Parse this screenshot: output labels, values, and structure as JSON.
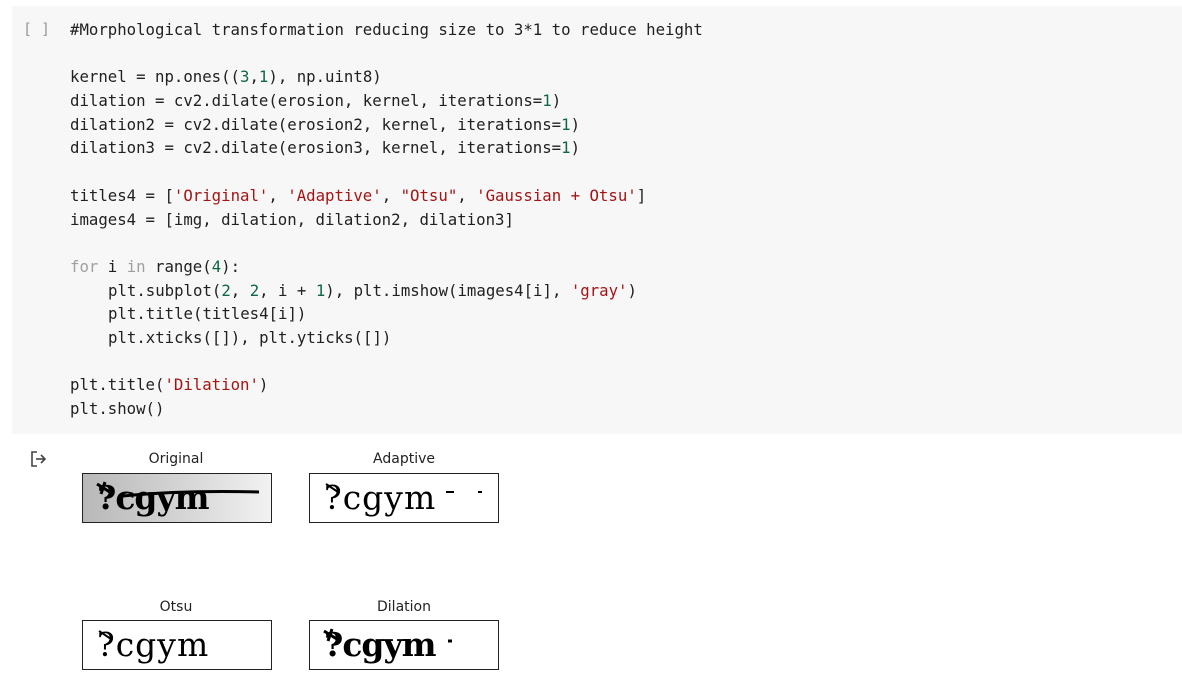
{
  "cell": {
    "run_label": "[ ]",
    "lines": [
      {
        "indent": 0,
        "tokens": [
          {
            "t": "#Morphological transformation reducing size to 3*1 to reduce height",
            "c": "c-comment"
          }
        ]
      },
      {
        "indent": 0,
        "tokens": []
      },
      {
        "indent": 0,
        "tokens": [
          {
            "t": "kernel = np.ones((",
            "c": "c-code"
          },
          {
            "t": "3",
            "c": "c-num"
          },
          {
            "t": ",",
            "c": "c-code"
          },
          {
            "t": "1",
            "c": "c-num"
          },
          {
            "t": "), np.uint8)",
            "c": "c-code"
          }
        ]
      },
      {
        "indent": 0,
        "tokens": [
          {
            "t": "dilation = cv2.dilate(erosion, kernel, iterations=",
            "c": "c-code"
          },
          {
            "t": "1",
            "c": "c-num"
          },
          {
            "t": ")",
            "c": "c-code"
          }
        ]
      },
      {
        "indent": 0,
        "tokens": [
          {
            "t": "dilation2 = cv2.dilate(erosion2, kernel, iterations=",
            "c": "c-code"
          },
          {
            "t": "1",
            "c": "c-num"
          },
          {
            "t": ")",
            "c": "c-code"
          }
        ]
      },
      {
        "indent": 0,
        "tokens": [
          {
            "t": "dilation3 = cv2.dilate(erosion3, kernel, iterations=",
            "c": "c-code"
          },
          {
            "t": "1",
            "c": "c-num"
          },
          {
            "t": ")",
            "c": "c-code"
          }
        ]
      },
      {
        "indent": 0,
        "tokens": []
      },
      {
        "indent": 0,
        "tokens": [
          {
            "t": "titles4 = [",
            "c": "c-code"
          },
          {
            "t": "'Original'",
            "c": "c-str"
          },
          {
            "t": ", ",
            "c": "c-code"
          },
          {
            "t": "'Adaptive'",
            "c": "c-str"
          },
          {
            "t": ", ",
            "c": "c-code"
          },
          {
            "t": "\"Otsu\"",
            "c": "c-str"
          },
          {
            "t": ", ",
            "c": "c-code"
          },
          {
            "t": "'Gaussian + Otsu'",
            "c": "c-str"
          },
          {
            "t": "]",
            "c": "c-code"
          }
        ]
      },
      {
        "indent": 0,
        "tokens": [
          {
            "t": "images4 = [img, dilation, dilation2, dilation3]",
            "c": "c-code"
          }
        ]
      },
      {
        "indent": 0,
        "tokens": []
      },
      {
        "indent": 0,
        "tokens": [
          {
            "t": "for",
            "c": "c-kw"
          },
          {
            "t": " i ",
            "c": "c-code"
          },
          {
            "t": "in",
            "c": "c-kw"
          },
          {
            "t": " range(",
            "c": "c-code"
          },
          {
            "t": "4",
            "c": "c-num"
          },
          {
            "t": "):",
            "c": "c-code"
          }
        ]
      },
      {
        "indent": 1,
        "tokens": [
          {
            "t": "plt.subplot(",
            "c": "c-code"
          },
          {
            "t": "2",
            "c": "c-num"
          },
          {
            "t": ", ",
            "c": "c-code"
          },
          {
            "t": "2",
            "c": "c-num"
          },
          {
            "t": ", i + ",
            "c": "c-code"
          },
          {
            "t": "1",
            "c": "c-num"
          },
          {
            "t": "), plt.imshow(images4[i], ",
            "c": "c-code"
          },
          {
            "t": "'gray'",
            "c": "c-str"
          },
          {
            "t": ")",
            "c": "c-code"
          }
        ]
      },
      {
        "indent": 1,
        "tokens": [
          {
            "t": "plt.title(titles4[i])",
            "c": "c-code"
          }
        ]
      },
      {
        "indent": 1,
        "tokens": [
          {
            "t": "plt.xticks([]), plt.yticks([])",
            "c": "c-code"
          }
        ]
      },
      {
        "indent": 0,
        "tokens": []
      },
      {
        "indent": 0,
        "tokens": [
          {
            "t": "plt.title(",
            "c": "c-code"
          },
          {
            "t": "'Dilation'",
            "c": "c-str"
          },
          {
            "t": ")",
            "c": "c-code"
          }
        ]
      },
      {
        "indent": 0,
        "tokens": [
          {
            "t": "plt.show()",
            "c": "c-code"
          }
        ]
      }
    ]
  },
  "output": {
    "icon": "output-redirect-icon",
    "panels": [
      {
        "title": "Original",
        "captcha": "?cgym"
      },
      {
        "title": "Adaptive",
        "captcha": "?cgym"
      },
      {
        "title": "Otsu",
        "captcha": "?cgym"
      },
      {
        "title": "Dilation",
        "captcha": "?cgym"
      }
    ]
  },
  "colors": {
    "cell_bg": "#f7f7f7",
    "code_text": "#212121",
    "comment": "#212121",
    "number": "#116644",
    "string": "#a31515",
    "keyword": "#a0a0a0",
    "run_bracket": "#999999"
  }
}
